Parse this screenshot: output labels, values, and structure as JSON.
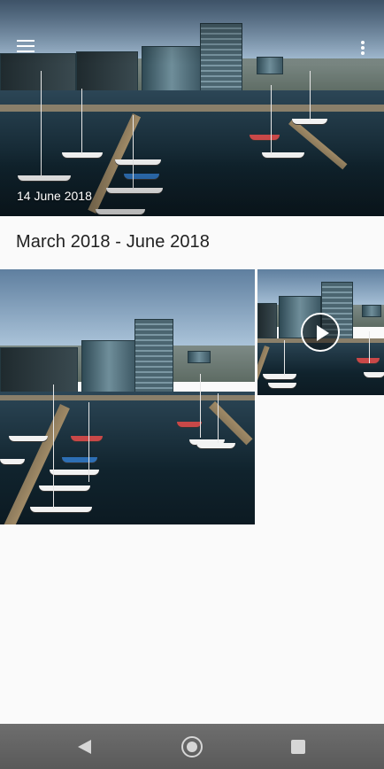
{
  "app": {
    "menu_icon": "menu-icon",
    "more_icon": "more-vertical-icon"
  },
  "hero": {
    "date": "14 June 2018"
  },
  "section": {
    "title": "March 2018 - June 2018"
  },
  "grid": {
    "items": [
      {
        "type": "photo"
      },
      {
        "type": "video",
        "overlay_icon": "play-icon"
      }
    ]
  },
  "navigation_bar": {
    "back_icon": "back-icon",
    "home_icon": "home-icon",
    "recents_icon": "recents-icon"
  },
  "colors": {
    "background": "#fafafa",
    "title_text": "#212121",
    "nav_bar": "#646464"
  }
}
